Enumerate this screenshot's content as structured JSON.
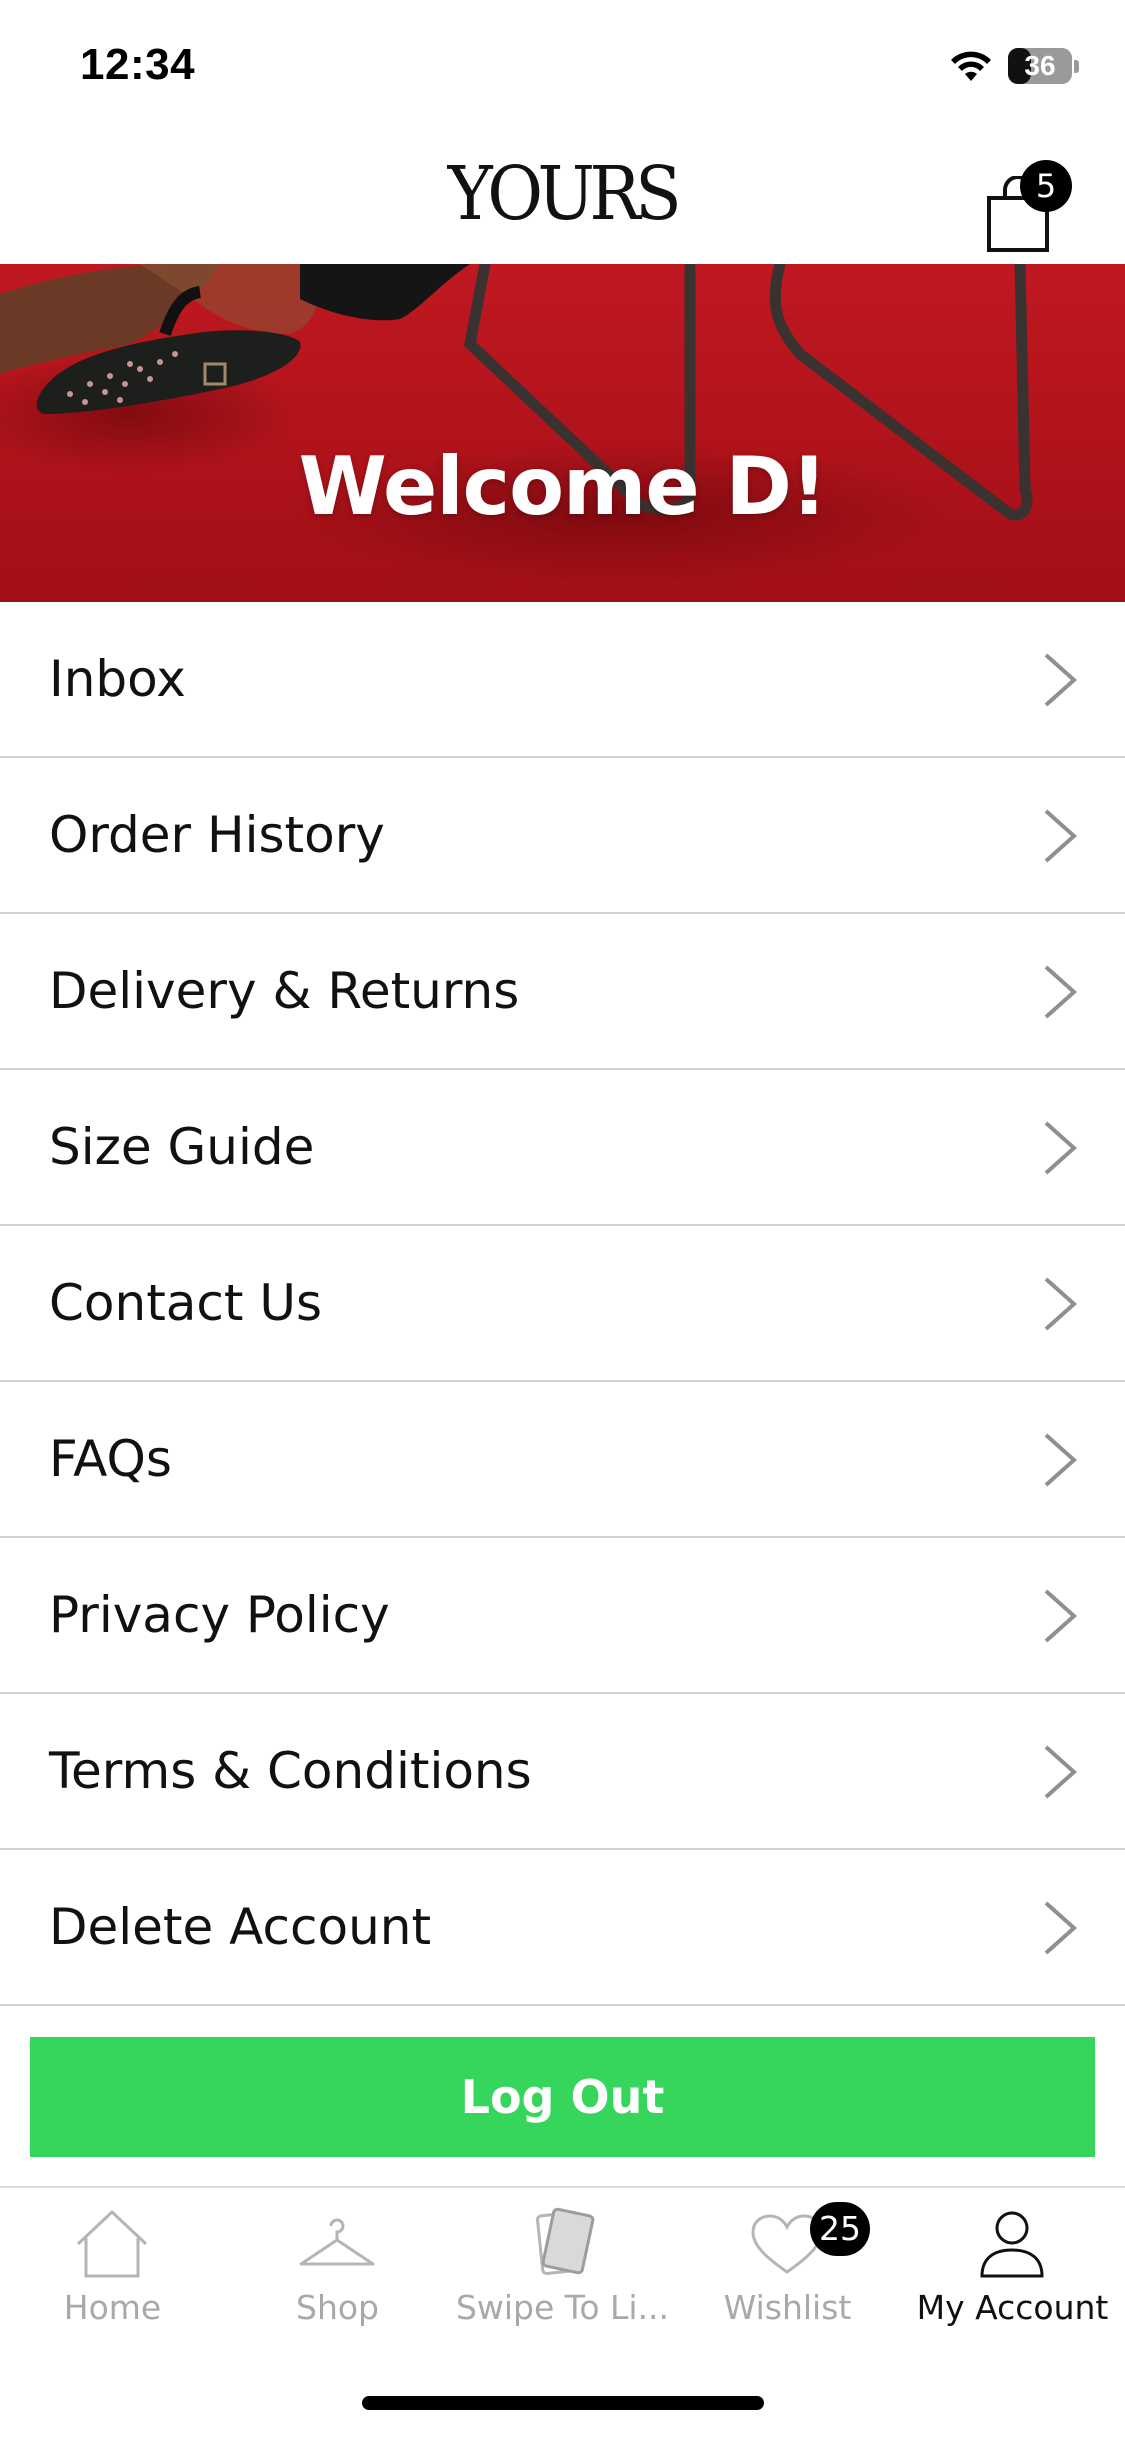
{
  "status_bar": {
    "time": "12:34",
    "battery_percent": "36",
    "battery_level": 0.36,
    "icons": [
      "wifi-icon",
      "battery-icon"
    ]
  },
  "header": {
    "brand": "YOURS",
    "cart_count": "5",
    "icons": [
      "shopping-bag-icon"
    ]
  },
  "hero": {
    "title": "Welcome D!",
    "background_color": "#b4131a"
  },
  "menu": {
    "items": [
      {
        "label": "Inbox"
      },
      {
        "label": "Order History"
      },
      {
        "label": "Delivery & Returns"
      },
      {
        "label": "Size Guide"
      },
      {
        "label": "Contact Us"
      },
      {
        "label": "FAQs"
      },
      {
        "label": "Privacy Policy"
      },
      {
        "label": "Terms & Conditions"
      },
      {
        "label": "Delete Account"
      }
    ],
    "chevron_icon": "chevron-right-icon"
  },
  "logout": {
    "label": "Log Out",
    "color": "#36d65c"
  },
  "tab_bar": {
    "tabs": [
      {
        "label": "Home",
        "icon": "home-icon"
      },
      {
        "label": "Shop",
        "icon": "hanger-icon"
      },
      {
        "label": "Swipe To Li...",
        "icon": "swipe-cards-icon"
      },
      {
        "label": "Wishlist",
        "icon": "heart-icon",
        "badge": "25"
      },
      {
        "label": "My Account",
        "icon": "user-icon",
        "active": true
      }
    ]
  },
  "colors": {
    "accent_green": "#36d65c",
    "inactive_tab": "#a9a9a9",
    "active_tab": "#111111",
    "divider": "#cfcfcf"
  }
}
